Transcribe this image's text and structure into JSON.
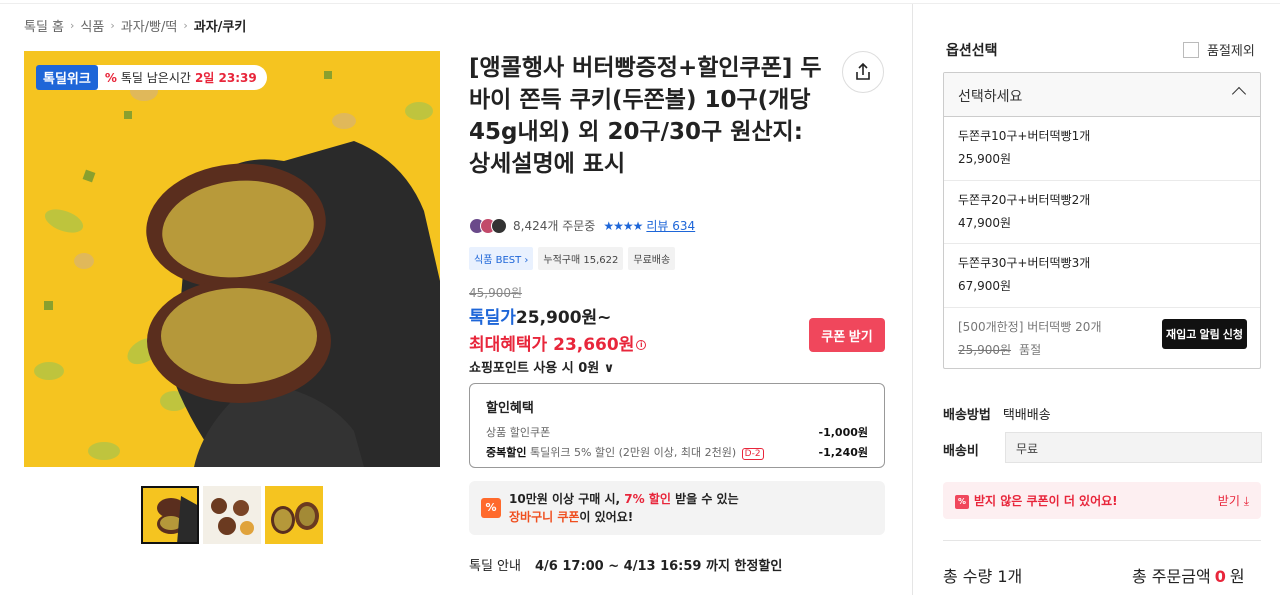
{
  "breadcrumb": [
    "톡딜 홈",
    "식품",
    "과자/빵/떡",
    "과자/쿠키"
  ],
  "image": {
    "brand_badge": "톡딜위크",
    "timer_label": "톡딜 남은시간",
    "timer_value": "2일 23:39"
  },
  "product": {
    "title": "[앵콜행사 버터빵증정+할인쿠폰] 두바이 쫀득 쿠키(두쫀볼) 10구(개당45g내외) 외 20구/30구 원산지: 상세설명에 표시",
    "order_count": "8,424개 주문중",
    "stars": "★★★★",
    "review_label": "리뷰 634",
    "tags": [
      {
        "label": "식품 BEST ›",
        "kind": "best"
      },
      {
        "label": "누적구매 15,622",
        "kind": "plain"
      },
      {
        "label": "무료배송",
        "kind": "plain"
      }
    ],
    "original_price": "45,900원",
    "deal_label": "톡딜가",
    "deal_price": "25,900원~",
    "max_benefit": "최대혜택가 23,660원",
    "coupon_button": "쿠폰 받기",
    "points": "쇼핑포인트 사용 시 0원 ∨"
  },
  "discount": {
    "title": "할인혜택",
    "rows": [
      {
        "label": "상품 할인쿠폰",
        "bold": "",
        "amount": "-1,000원",
        "dday": ""
      },
      {
        "label": "톡딜위크 5% 할인 (2만원 이상, 최대 2천원)",
        "bold": "중복할인",
        "amount": "-1,240원",
        "dday": "D-2"
      }
    ]
  },
  "promo": {
    "icon": "%",
    "line1_a": "10만원 이상 구매 시, ",
    "line1_red": "7% 할인",
    "line1_b": " 받을 수 있는",
    "line2_ora": "장바구니 쿠폰",
    "line2_b": "이 있어요!"
  },
  "deal_info": {
    "label": "톡딜 안내",
    "value": "4/6 17:00 ~ 4/13 16:59 까지 한정할인"
  },
  "options": {
    "title": "옵션선택",
    "soldout_toggle": "품절제외",
    "placeholder": "선택하세요",
    "items": [
      {
        "name": "두쫀쿠10구+버터떡빵1개",
        "price": "25,900원"
      },
      {
        "name": "두쫀쿠20구+버터떡빵2개",
        "price": "47,900원"
      },
      {
        "name": "두쫀쿠30구+버터떡빵3개",
        "price": "67,900원"
      }
    ],
    "soldout_item": {
      "name": "[500개한정] 버터떡빵 20개",
      "price": "25,900원",
      "status": "품절",
      "button": "재입고 알림 신청"
    }
  },
  "shipping": {
    "method_label": "배송방법",
    "method_value": "택배배송",
    "fee_label": "배송비",
    "fee_value": "무료"
  },
  "unclaimed": {
    "icon": "%",
    "text": "받지 않은 쿠폰이 더 있어요!",
    "action": "받기 ⤓"
  },
  "totals": {
    "qty_label": "총 수량 1개",
    "amount_label": "총 주문금액",
    "amount_value": "0",
    "amount_unit": "원"
  },
  "colors": {
    "blue": "#1e66d8",
    "red": "#e8263b",
    "coupon": "#f0475c",
    "yellow": "#f5c420"
  }
}
